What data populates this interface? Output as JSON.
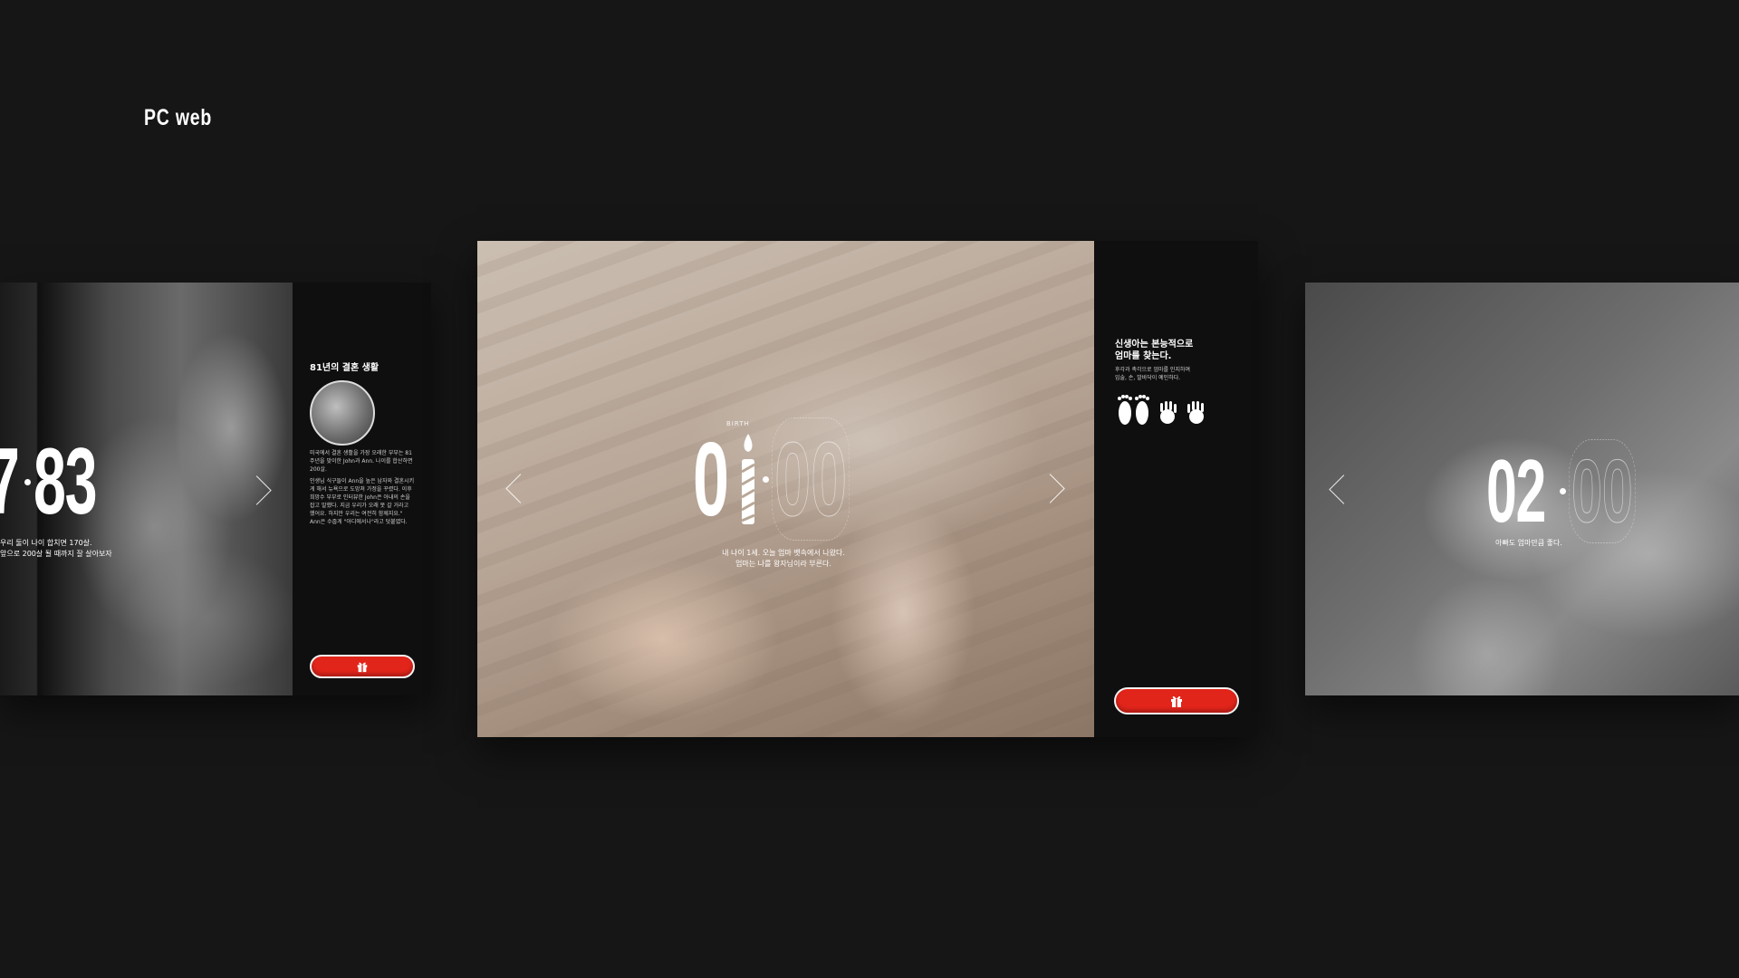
{
  "page": {
    "section_label": "PC web"
  },
  "cards": {
    "left": {
      "counter": {
        "main": "7",
        "after": "83"
      },
      "caption": [
        "우리 둘이 나이 합치면 170살.",
        "앞으로 200살 될 때까지 잘 살아보자"
      ],
      "panel_title": "81년의 결혼 생활",
      "panel_text": [
        "미국에서 결혼 생활을 가장 오래한 부부는 81주년을 맞이한 John과 Ann. 나이를 합산하면 200살.",
        "인생님 식구들이 Ann을 높은 남자와 결혼시키게 해서 뉴욕으로 도망쳐 가정을 꾸렸다. 이후 희망수 부부로 인터뷰한 John은 아내의 손을 잡고 말했다. 지금 우리가 오래 못 갈 거라고 했어요. 하지만 우리는 여전히 함께지요.\" Ann은 수줍게 \"아디에서나\"라고 덧붙였다."
      ]
    },
    "center": {
      "birth_tag": "BIRTH",
      "counter": {
        "main": "01",
        "ghost": "00"
      },
      "caption": [
        "내 나이 1세. 오늘 엄마 뱃속에서 나왔다.",
        "엄마는 나를 왕자님이라 부른다."
      ],
      "panel_title": [
        "신생아는 본능적으로",
        "엄마를 찾는다."
      ],
      "panel_text": [
        "후각과 촉각으로 엄마를 인지하며",
        "입술, 손, 발바닥이 예민하다."
      ]
    },
    "right": {
      "counter": {
        "main": "02",
        "ghost": "00"
      },
      "caption": [
        "아빠도 엄마만큼 좋다."
      ]
    }
  },
  "icons": {
    "gift": "gift-icon",
    "footprints": "footprints-icon",
    "handprints": "handprints-icon",
    "candle": "candle-icon"
  },
  "colors": {
    "background": "#161616",
    "accent": "#e2251b",
    "panel": "#0f0f0f"
  }
}
